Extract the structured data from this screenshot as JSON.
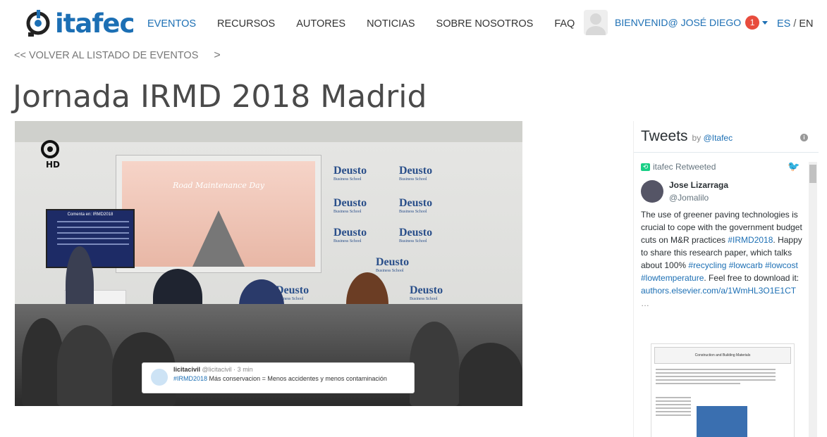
{
  "header": {
    "logo_text": "itafec",
    "nav": [
      {
        "label": "EVENTOS",
        "active": true
      },
      {
        "label": "RECURSOS",
        "active": false
      },
      {
        "label": "AUTORES",
        "active": false
      },
      {
        "label": "NOTICIAS",
        "active": false
      },
      {
        "label": "SOBRE NOSOTROS",
        "active": false
      },
      {
        "label": "FAQ",
        "active": false
      }
    ],
    "user_greeting": "BIENVENID@ JOSÉ DIEGO",
    "notification_count": "1",
    "lang_es": "ES",
    "lang_sep": "/",
    "lang_en": "EN"
  },
  "back_link": "<< VOLVER AL LISTADO DE EVENTOS",
  "back_chevron": ">",
  "page_title": "Jornada IRMD 2018 Madrid",
  "video": {
    "overlay_user": "licitacivil",
    "overlay_handle": "@licitacivil · 3 min",
    "overlay_hashtag": "#IRMD2018",
    "overlay_text": "Más conservacion = Menos accidentes y menos contaminación",
    "monitor_title": "Comenta en: IRMD2018",
    "screen_label": "Road Maintenance Day",
    "hd_label": "HD",
    "brand": "Deusto",
    "brand_sub": "Business School"
  },
  "tweets": {
    "heading": "Tweets",
    "by_label": "by",
    "by_handle": "@Itafec",
    "retweeted_label": "itafec Retweeted",
    "author_name": "Jose Lizarraga",
    "author_handle": "@Jomalilo",
    "body_plain_1": "The use of greener paving technologies is crucial to cope with the government budget cuts on M&R practices ",
    "body_hash_1": "#IRMD2018",
    "body_plain_2": ". Happy to share this research paper, which talks about 100% ",
    "body_hash_2": "#recycling #lowcarb #lowcost #lowtemperature",
    "body_plain_3": ". Feel free to download it: ",
    "body_link": "authors.elsevier.com/a/1WmHL3O1E1CT",
    "body_ellipsis": "…",
    "paper_journal": "Construction and Building Materials"
  },
  "colors": {
    "brand_blue": "#1c6fb4",
    "badge_red": "#e84c3d",
    "retweet_green": "#19cf86"
  }
}
